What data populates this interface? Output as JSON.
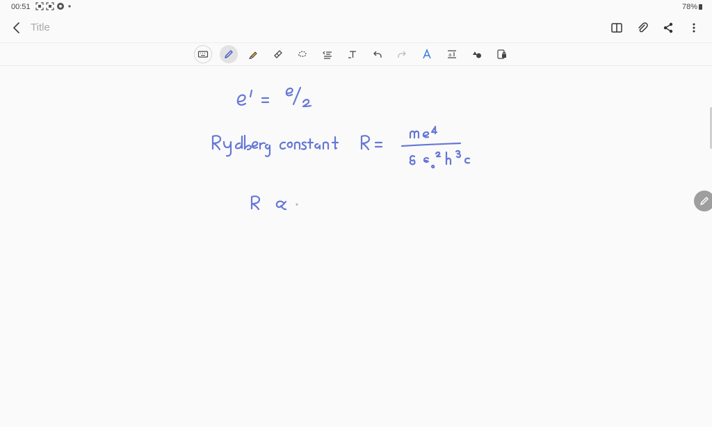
{
  "status_bar": {
    "time": "00:51",
    "battery": "78%"
  },
  "header": {
    "title": "Title"
  },
  "toolbar": {
    "tools": [
      {
        "name": "keyboard"
      },
      {
        "name": "pen"
      },
      {
        "name": "highlighter"
      },
      {
        "name": "eraser"
      },
      {
        "name": "lasso-select"
      },
      {
        "name": "shape"
      },
      {
        "name": "text-mode"
      },
      {
        "name": "undo"
      },
      {
        "name": "redo"
      },
      {
        "name": "ai-writing"
      },
      {
        "name": "insert-text"
      },
      {
        "name": "shapes"
      },
      {
        "name": "lock"
      }
    ]
  },
  "colors": {
    "ink": "#6577d6",
    "background": "#fafafa",
    "icon": "#333333"
  },
  "note": {
    "lines": [
      "e' = e/2",
      "Rydberg constant  R = me⁴ / 8ε₀²h³c",
      "R ∝"
    ]
  }
}
